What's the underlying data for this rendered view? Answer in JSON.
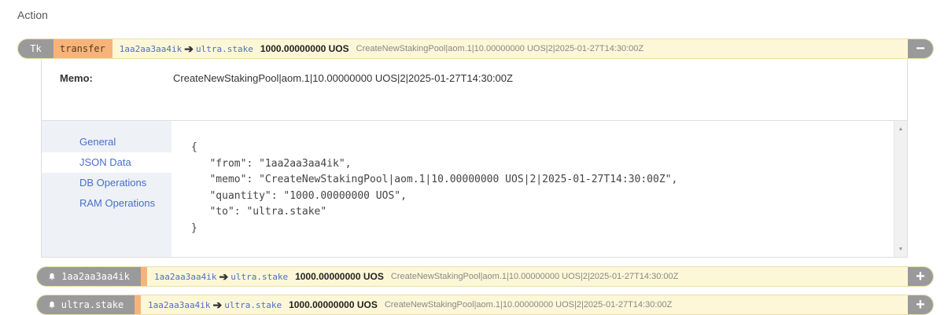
{
  "page": {
    "title": "Action"
  },
  "action": {
    "badge": "Tk",
    "name": "transfer",
    "from": "1aa2aa3aa4ik",
    "to": "ultra.stake",
    "amount": "1000.00000000 UOS",
    "memo": "CreateNewStakingPool|aom.1|10.00000000 UOS|2|2025-01-27T14:30:00Z",
    "toggle": "−"
  },
  "detail": {
    "memo_label": "Memo:",
    "memo_value": "CreateNewStakingPool|aom.1|10.00000000 UOS|2|2025-01-27T14:30:00Z",
    "tabs": [
      "General",
      "JSON Data",
      "DB Operations",
      "RAM Operations"
    ],
    "active_tab": "JSON Data",
    "json_lines": [
      "{",
      "   \"from\": \"1aa2aa3aa4ik\",",
      "   \"memo\": \"CreateNewStakingPool|aom.1|10.00000000 UOS|2|2025-01-27T14:30:00Z\",",
      "   \"quantity\": \"1000.00000000 UOS\",",
      "   \"to\": \"ultra.stake\"",
      "}"
    ]
  },
  "notifications": [
    {
      "account": "1aa2aa3aa4ik",
      "from": "1aa2aa3aa4ik",
      "to": "ultra.stake",
      "amount": "1000.00000000 UOS",
      "memo": "CreateNewStakingPool|aom.1|10.00000000 UOS|2|2025-01-27T14:30:00Z",
      "toggle": "+"
    },
    {
      "account": "ultra.stake",
      "from": "1aa2aa3aa4ik",
      "to": "ultra.stake",
      "amount": "1000.00000000 UOS",
      "memo": "CreateNewStakingPool|aom.1|10.00000000 UOS|2|2025-01-27T14:30:00Z",
      "toggle": "+"
    }
  ],
  "colors": {
    "bar_bg": "#fdf7d8",
    "pill": "#9a9a9a",
    "name_tag": "#f6b47a",
    "link": "#4a6fc7"
  }
}
